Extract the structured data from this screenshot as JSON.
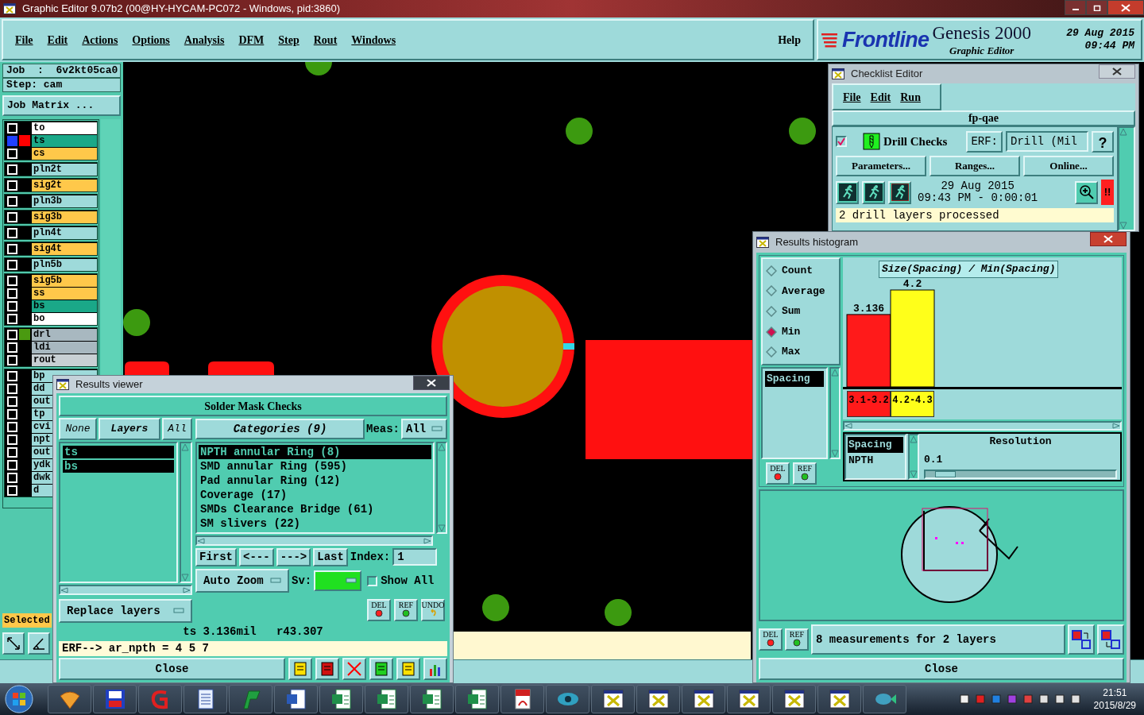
{
  "window": {
    "title": "Graphic Editor 9.07b2 (00@HY-HYCAM-PC072 - Windows, pid:3860)"
  },
  "menu": [
    "File",
    "Edit",
    "Actions",
    "Options",
    "Analysis",
    "DFM",
    "Step",
    "Rout",
    "Windows"
  ],
  "help_menu": "Help",
  "brand": {
    "logo": "Frontline",
    "product": "Genesis 2000",
    "subtitle": "Graphic Editor",
    "date": "29 Aug 2015",
    "time": "09:44 PM"
  },
  "job": {
    "job": "Job  :  6v2kt05ca0",
    "step": "Step: cam",
    "matrix_button": "Job Matrix ..."
  },
  "layer_groups": [
    [
      {
        "name": "to",
        "color": "#ffffff",
        "selected": false
      },
      {
        "name": "ts",
        "color": "#1aa888",
        "marker": {
          "color": "#ff0000"
        },
        "selected": true
      },
      {
        "name": "cs",
        "color": "#ffc84a",
        "selected": false
      }
    ],
    [
      {
        "name": "pln2t",
        "color": "#9edada",
        "selected": false
      }
    ],
    [
      {
        "name": "sig2t",
        "color": "#ffc84a",
        "selected": false
      }
    ],
    [
      {
        "name": "pln3b",
        "color": "#9edada",
        "selected": false
      }
    ],
    [
      {
        "name": "sig3b",
        "color": "#ffc84a",
        "selected": false
      }
    ],
    [
      {
        "name": "pln4t",
        "color": "#9edada",
        "selected": false
      }
    ],
    [
      {
        "name": "sig4t",
        "color": "#ffc84a",
        "selected": false
      }
    ],
    [
      {
        "name": "pln5b",
        "color": "#9edada",
        "selected": false
      }
    ],
    [
      {
        "name": "sig5b",
        "color": "#ffc84a",
        "selected": false
      },
      {
        "name": "ss",
        "color": "#ffc84a",
        "selected": false
      },
      {
        "name": "bs",
        "color": "#1aa888",
        "selected": false
      },
      {
        "name": "bo",
        "color": "#ffffff",
        "selected": false
      }
    ],
    [
      {
        "name": "drl",
        "color": "#a8b8c0",
        "marker": {
          "color": "#4a9a10"
        },
        "selected": false
      },
      {
        "name": "ldi",
        "color": "#a8b8c0",
        "selected": false
      },
      {
        "name": "rout",
        "color": "#c8d0d4",
        "selected": false
      }
    ],
    [
      {
        "name": "bp",
        "color": "#9edada",
        "selected": false
      },
      {
        "name": "dd",
        "color": "#9edada",
        "selected": false
      },
      {
        "name": "out",
        "color": "#9edada",
        "selected": false
      },
      {
        "name": "tp",
        "color": "#9edada",
        "selected": false
      },
      {
        "name": "cvi",
        "color": "#9edada",
        "selected": false
      },
      {
        "name": "npt",
        "color": "#9edada",
        "selected": false
      },
      {
        "name": "out",
        "color": "#9edada",
        "selected": false
      },
      {
        "name": "ydk",
        "color": "#9edada",
        "selected": false
      },
      {
        "name": "dwk",
        "color": "#9edada",
        "selected": false
      },
      {
        "name": "d",
        "color": "#9edada",
        "selected": false
      }
    ]
  ],
  "selected_label": "Selected",
  "results_viewer": {
    "title": "Results viewer",
    "heading": "Solder Mask Checks",
    "layer_buttons": [
      "None",
      "Layers",
      "All"
    ],
    "layers": [
      {
        "name": "ts",
        "selected": true
      },
      {
        "name": "bs",
        "selected": true
      }
    ],
    "categories_button": "Categories (9)",
    "meas_label": "Meas:",
    "meas_value": "All",
    "categories": [
      {
        "label": "NPTH annular Ring (8)",
        "selected": true
      },
      {
        "label": "SMD annular Ring (595)",
        "selected": false
      },
      {
        "label": "Pad annular Ring (12)",
        "selected": false
      },
      {
        "label": "Coverage (17)",
        "selected": false
      },
      {
        "label": "SMDs Clearance Bridge (61)",
        "selected": false
      },
      {
        "label": "SM slivers (22)",
        "selected": false
      }
    ],
    "nav": [
      "First",
      "<---",
      "--->",
      "Last"
    ],
    "index_label": "Index:",
    "index_value": "1",
    "zoom": "Auto Zoom",
    "sv_label": "Sv:",
    "show_all": {
      "label": "Show All",
      "checked": false
    },
    "replace": "Replace layers",
    "tool_buttons": [
      "DEL",
      "REF",
      "UNDO"
    ],
    "measure": "ts 3.136mil   r43.307",
    "erf": "ERF--> ar_npth = 4 5 7",
    "close": "Close"
  },
  "checklist": {
    "title": "Checklist Editor",
    "menu": [
      "File",
      "Edit",
      "Run"
    ],
    "name": "fp-qae",
    "check": {
      "checked": true,
      "label": "Drill Checks"
    },
    "erf_label": "ERF:",
    "erf_value": "Drill (Mil",
    "help": "?",
    "buttons": [
      "Parameters...",
      "Ranges...",
      "Online..."
    ],
    "date": "29 Aug 2015",
    "time": "09:43 PM - 0:00:01",
    "alert": "!!",
    "message": "2 drill layers processed"
  },
  "histogram": {
    "title": "Results histogram",
    "modes": [
      {
        "label": "Count",
        "selected": false
      },
      {
        "label": "Average",
        "selected": false
      },
      {
        "label": "Sum",
        "selected": false
      },
      {
        "label": "Min",
        "selected": true
      },
      {
        "label": "Max",
        "selected": false
      }
    ],
    "list": [
      {
        "label": "Spacing",
        "selected": true
      }
    ],
    "side_buttons": [
      "DEL",
      "REF"
    ],
    "chart_data": {
      "type": "bar",
      "title": "Size(Spacing) / Min(Spacing)",
      "categories": [
        "3.1-3.2",
        "4.2-4.3"
      ],
      "stacked": true,
      "data_labels": true,
      "series": [
        {
          "color": "#ff1a1a",
          "values": [
            3.136,
            null
          ]
        },
        {
          "color": "#ffff1a",
          "values": [
            null,
            4.2
          ]
        }
      ]
    },
    "attributes": [
      {
        "label": "Spacing",
        "selected": true
      },
      {
        "label": "NPTH",
        "selected": false
      }
    ],
    "resolution_label": "Resolution",
    "resolution_value": "0.1",
    "resolution": {
      "level": 0.05
    },
    "bottom_buttons": [
      "DEL",
      "REF"
    ],
    "summary": "8 measurements for 2 layers",
    "close": "Close"
  },
  "taskbar": {
    "time": "21:51",
    "date": "2015/8/29"
  }
}
